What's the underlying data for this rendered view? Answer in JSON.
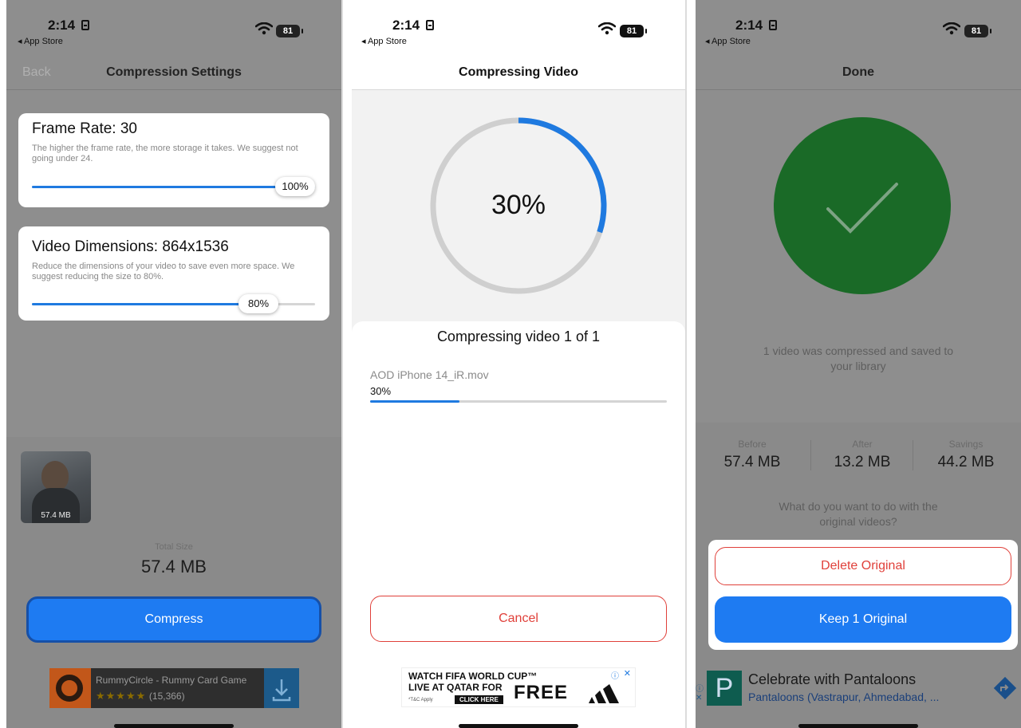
{
  "status": {
    "time": "2:14",
    "back_app": "◂ App Store",
    "battery": "81"
  },
  "screen1": {
    "back_label": "Back",
    "title": "Compression Settings",
    "frame_rate": {
      "title": "Frame Rate: 30",
      "description": "The higher the frame rate, the more storage it takes. We suggest not going under 24.",
      "value_label": "100%",
      "level": 1.0
    },
    "dimensions": {
      "title": "Video Dimensions: 864x1536",
      "description": "Reduce the dimensions of your video to save even more space. We suggest reducing the size to 80%.",
      "value_label": "80%",
      "level": 0.8
    },
    "thumbnail_size": "57.4 MB",
    "total_size_label": "Total Size",
    "total_size": "57.4 MB",
    "compress_button": "Compress",
    "ad": {
      "text": "RummyCircle - Rummy Card Game",
      "stars": "★★★★★",
      "rating_count": "(15,366)"
    }
  },
  "screen2": {
    "title": "Compressing Video",
    "percent_label": "30%",
    "progress": 0.3,
    "heading": "Compressing video 1 of 1",
    "file_name": "AOD iPhone 14_iR.mov",
    "file_percent": "30%",
    "cancel_button": "Cancel",
    "ad": {
      "line1": "WATCH FIFA WORLD CUP™",
      "line2": "LIVE AT QATAR FOR",
      "free": "FREE",
      "tc": "*T&C Apply",
      "cta": "CLICK HERE"
    }
  },
  "screen3": {
    "title": "Done",
    "message": "1 video was compressed and saved to your library",
    "stats": [
      {
        "label": "Before",
        "value": "57.4 MB"
      },
      {
        "label": "After",
        "value": "13.2 MB"
      },
      {
        "label": "Savings",
        "value": "44.2 MB"
      }
    ],
    "question": "What do you want to do with the original videos?",
    "delete_button": "Delete Original",
    "keep_button": "Keep 1 Original",
    "ad": {
      "title": "Celebrate with Pantaloons",
      "subtitle": "Pantaloons (Vastrapur, Ahmedabad, ...",
      "logo": "P"
    }
  },
  "colors": {
    "accent": "#1f7ae0",
    "destructive": "#e0403a",
    "success": "#1f7a2e",
    "dim_overlay": "#8e8e8e"
  }
}
